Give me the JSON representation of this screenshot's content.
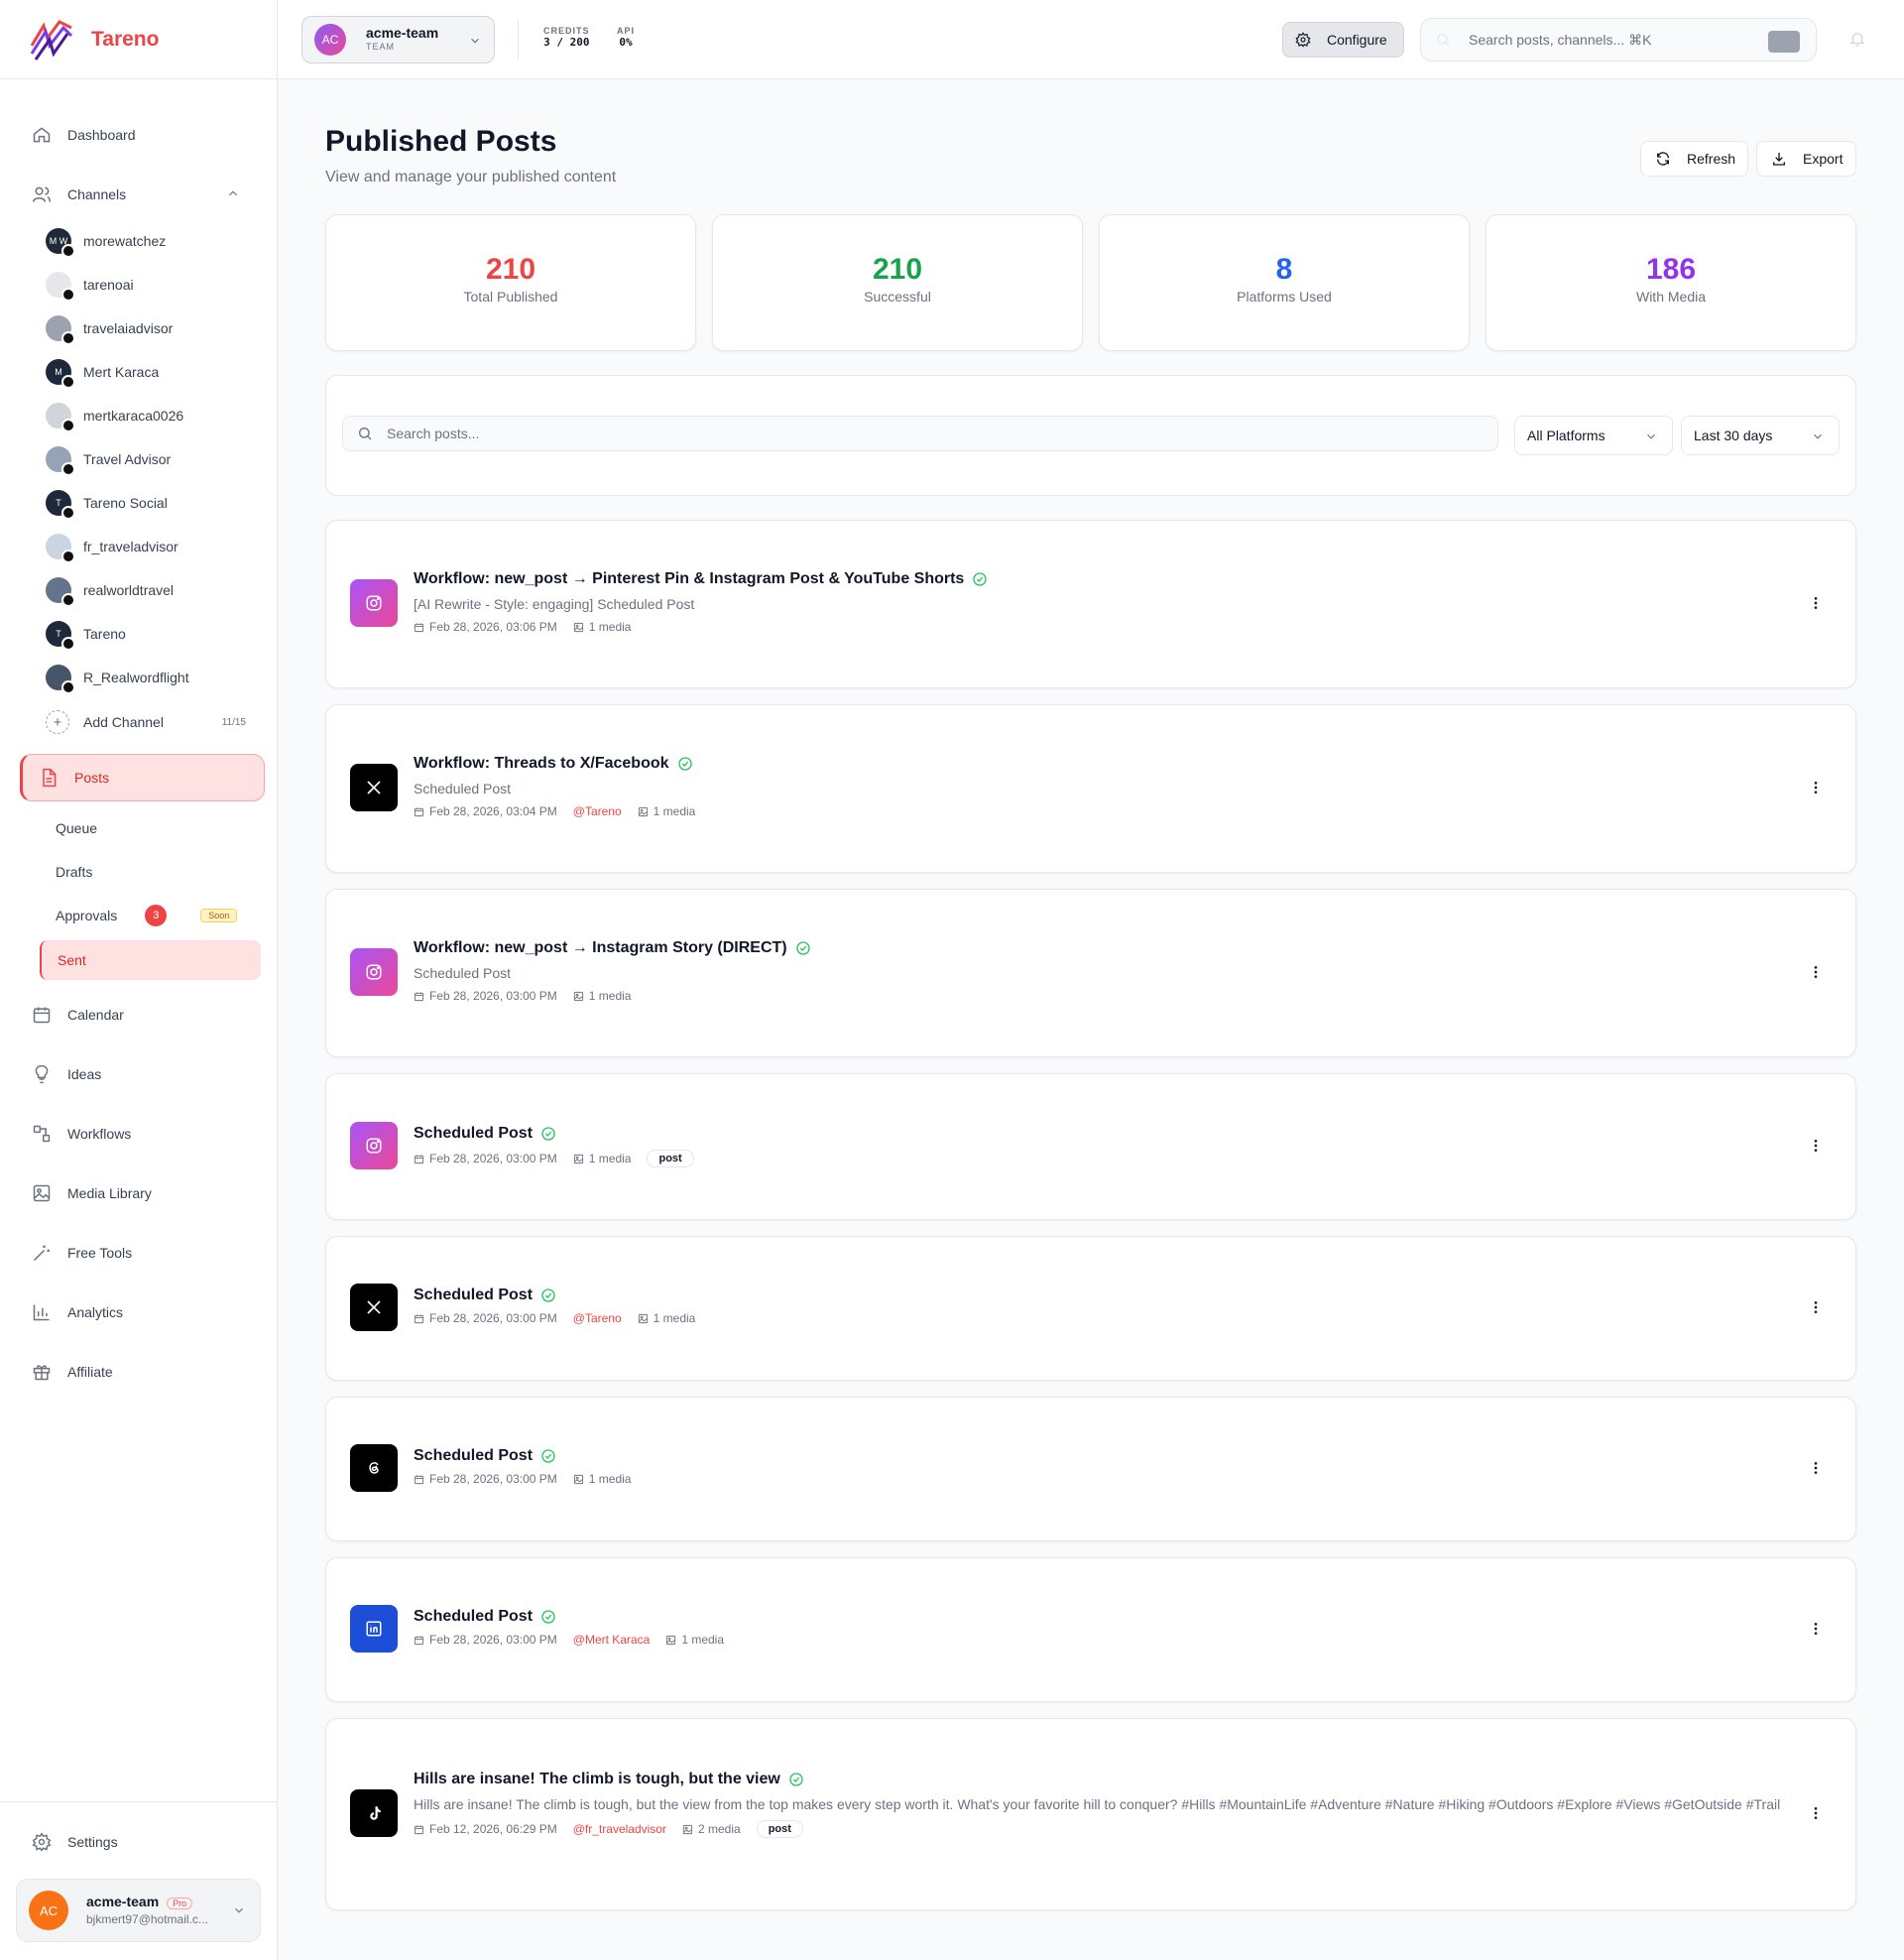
{
  "brand": {
    "name": "Tareno"
  },
  "nav": {
    "dashboard": "Dashboard",
    "channels": "Channels",
    "posts": "Posts",
    "calendar": "Calendar",
    "ideas": "Ideas",
    "workflows": "Workflows",
    "media_library": "Media Library",
    "free_tools": "Free Tools",
    "analytics": "Analytics",
    "affiliate": "Affiliate",
    "settings": "Settings"
  },
  "channels": [
    {
      "name": "morewatchez",
      "initials": "M W",
      "platform": "threads",
      "color": "#1f2937"
    },
    {
      "name": "tarenoai",
      "initials": "",
      "platform": "threads",
      "color": "#e5e7eb"
    },
    {
      "name": "travelaiadvisor",
      "initials": "",
      "platform": "threads",
      "color": "#9ca3af"
    },
    {
      "name": "Mert Karaca",
      "initials": "M",
      "platform": "linkedin",
      "color": "#1e293b"
    },
    {
      "name": "mertkaraca0026",
      "initials": "",
      "platform": "threads",
      "color": "#d1d5db"
    },
    {
      "name": "Travel Advisor",
      "initials": "",
      "platform": "threads",
      "color": "#94a3b8"
    },
    {
      "name": "Tareno Social",
      "initials": "T",
      "platform": "threads",
      "color": "#1e293b"
    },
    {
      "name": "fr_traveladvisor",
      "initials": "",
      "platform": "tiktok",
      "color": "#cbd5e1"
    },
    {
      "name": "realworldtravel",
      "initials": "",
      "platform": "tiktok",
      "color": "#64748b"
    },
    {
      "name": "Tareno",
      "initials": "T",
      "platform": "x",
      "color": "#1e293b"
    },
    {
      "name": "R_Realwordflight",
      "initials": "",
      "platform": "youtube",
      "color": "#475569"
    }
  ],
  "add_channel": {
    "label": "Add Channel",
    "count": "11/15"
  },
  "posts_sub": {
    "queue": "Queue",
    "drafts": "Drafts",
    "approvals": "Approvals",
    "approvals_count": "3",
    "soon": "Soon",
    "sent": "Sent"
  },
  "account": {
    "initials": "AC",
    "name": "acme-team",
    "plan": "Pro",
    "email": "bjkmert97@hotmail.c..."
  },
  "header": {
    "team_initials": "AC",
    "team_name": "acme-team",
    "team_sub": "TEAM",
    "credits_label": "CREDITS",
    "credits_value": "3 / 200",
    "api_label": "API",
    "api_value": "0%",
    "configure": "Configure",
    "search_placeholder": "Search posts, channels... ⌘K"
  },
  "page": {
    "title": "Published Posts",
    "subtitle": "View and manage your published content",
    "refresh": "Refresh",
    "export": "Export"
  },
  "stats": [
    {
      "value": "210",
      "label": "Total Published",
      "color": "#ef4444"
    },
    {
      "value": "210",
      "label": "Successful",
      "color": "#16a34a"
    },
    {
      "value": "8",
      "label": "Platforms Used",
      "color": "#2563eb"
    },
    {
      "value": "186",
      "label": "With Media",
      "color": "#9333ea"
    }
  ],
  "filters": {
    "search_placeholder": "Search posts...",
    "platform": "All Platforms",
    "range": "Last 30 days"
  },
  "posts": [
    {
      "platform": "instagram",
      "title": "Workflow: new_post → Pinterest Pin & Instagram Post & YouTube Shorts",
      "subtitle": "[AI Rewrite - Style: engaging] Scheduled Post",
      "date": "Feb 28, 2026, 03:06 PM",
      "handle": "",
      "media": "1 media",
      "tag": ""
    },
    {
      "platform": "x",
      "title": "Workflow: Threads to X/Facebook",
      "subtitle": "Scheduled Post",
      "date": "Feb 28, 2026, 03:04 PM",
      "handle": "@Tareno",
      "media": "1 media",
      "tag": ""
    },
    {
      "platform": "instagram",
      "title": "Workflow: new_post → Instagram Story (DIRECT)",
      "subtitle": "Scheduled Post",
      "date": "Feb 28, 2026, 03:00 PM",
      "handle": "",
      "media": "1 media",
      "tag": ""
    },
    {
      "platform": "instagram",
      "title": "Scheduled Post",
      "subtitle": "",
      "date": "Feb 28, 2026, 03:00 PM",
      "handle": "",
      "media": "1 media",
      "tag": "post"
    },
    {
      "platform": "x",
      "title": "Scheduled Post",
      "subtitle": "",
      "date": "Feb 28, 2026, 03:00 PM",
      "handle": "@Tareno",
      "media": "1 media",
      "tag": ""
    },
    {
      "platform": "threads",
      "title": "Scheduled Post",
      "subtitle": "",
      "date": "Feb 28, 2026, 03:00 PM",
      "handle": "",
      "media": "1 media",
      "tag": ""
    },
    {
      "platform": "linkedin",
      "title": "Scheduled Post",
      "subtitle": "",
      "date": "Feb 28, 2026, 03:00 PM",
      "handle": "@Mert Karaca",
      "media": "1 media",
      "tag": ""
    },
    {
      "platform": "tiktok",
      "title": "Hills are insane! The climb is tough, but the view",
      "subtitle": "Hills are insane! The climb is tough, but the view from the top makes every step worth it. What's your favorite hill to conquer? #Hills #MountainLife #Adventure #Nature #Hiking #Outdoors #Explore #Views #GetOutside #Trail",
      "date": "Feb 12, 2026, 06:29 PM",
      "handle": "@fr_traveladvisor",
      "media": "2 media",
      "tag": "post"
    }
  ]
}
